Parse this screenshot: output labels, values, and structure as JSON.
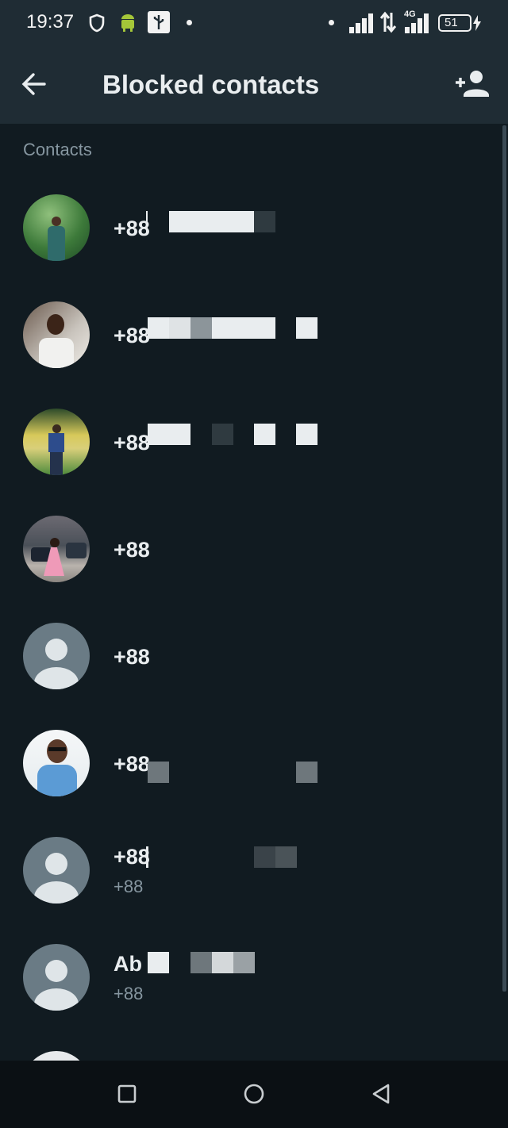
{
  "status_bar": {
    "time": "19:37",
    "battery": "51",
    "network": "4G",
    "icons": [
      "shield-icon",
      "android-icon",
      "usb-icon",
      "signal-icon",
      "data-arrows-icon",
      "battery-icon",
      "charging-icon"
    ]
  },
  "app_bar": {
    "title": "Blocked contacts",
    "back_icon": "arrow-back-icon",
    "add_icon": "add-contact-icon"
  },
  "section": {
    "label": "Contacts"
  },
  "contacts": [
    {
      "name": "+88",
      "avatar": "photo-outdoor-green"
    },
    {
      "name": "+88",
      "avatar": "photo-selfie"
    },
    {
      "name": "+88",
      "avatar": "photo-field"
    },
    {
      "name": "+88",
      "avatar": "photo-street"
    },
    {
      "name": "+88",
      "avatar": "default-avatar-icon"
    },
    {
      "name": "+88",
      "avatar": "photo-sunglasses"
    },
    {
      "name": "+88",
      "subtitle": "+88",
      "avatar": "default-avatar-icon"
    },
    {
      "name": "Ab",
      "subtitle": "+88",
      "avatar": "default-avatar-icon"
    }
  ],
  "colors": {
    "background": "#111b21",
    "app_bar": "#1f2c34",
    "text_primary": "#e9edef",
    "text_secondary": "#8696a0",
    "default_avatar_bg": "#6a7b85"
  },
  "nav_bar": {
    "icons": [
      "recents-square-icon",
      "home-circle-icon",
      "back-triangle-icon"
    ]
  }
}
